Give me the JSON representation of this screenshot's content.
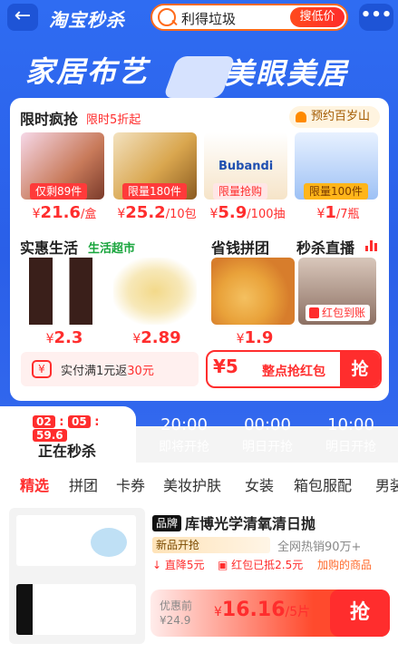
{
  "topbar": {
    "logo": "淘宝秒杀",
    "search_value": "利得垃圾",
    "search_button": "搜低价",
    "more": "•••"
  },
  "banner": {
    "left": "家居布艺",
    "right": "美眼美居"
  },
  "flash": {
    "title": "限时疯抢",
    "tag": "限时5折起",
    "reminder": "预约百岁山",
    "items": [
      {
        "caption": "仅剩89件",
        "price": "21.6",
        "unit": "/盒"
      },
      {
        "caption": "限量180件",
        "price": "25.2",
        "unit": "/10包"
      },
      {
        "caption": "限量抢购",
        "price": "5.9",
        "unit": "/100抽",
        "pic_text": "Bubandi"
      },
      {
        "caption": "限量100件",
        "price": "1",
        "unit": "/7瓶"
      }
    ]
  },
  "life": {
    "title": "实惠生活",
    "sub": "生活超市",
    "prices": [
      "2.3",
      "2.89"
    ]
  },
  "group": {
    "title": "省钱拼团",
    "price": "1.9"
  },
  "live": {
    "title": "秒杀直播",
    "badge": "红包到账"
  },
  "pay": {
    "prefix": "实付满1元返",
    "amount": "30元"
  },
  "redpack": {
    "amount": "¥5",
    "label": "整点抢红包",
    "grab": "抢"
  },
  "sessions": {
    "clock": [
      "02",
      "05",
      "59.6"
    ],
    "current": "正在秒杀",
    "slots": [
      {
        "time": "20:00",
        "status": "即将开抢"
      },
      {
        "time": "00:00",
        "status": "明日开抢"
      },
      {
        "time": "10:00",
        "status": "明日开抢"
      }
    ]
  },
  "categories": [
    "精选",
    "拼团",
    "卡券",
    "美妆护肤",
    "女装",
    "箱包服配",
    "男装"
  ],
  "product": {
    "brand_tag": "品牌",
    "title": "库博光学清氧清日抛",
    "new_tag": "新品开抢",
    "sold": "全网热销90万+",
    "down": "直降5元",
    "coupon": "红包已抵2.5元",
    "hint": "加购的商品",
    "before_label": "优惠前",
    "before_price": "¥24.9",
    "price": "16.16",
    "unit": "/5片",
    "buy": "抢"
  },
  "colors": {
    "accent": "#ff2d2d",
    "hero": "#2f6cf2"
  }
}
